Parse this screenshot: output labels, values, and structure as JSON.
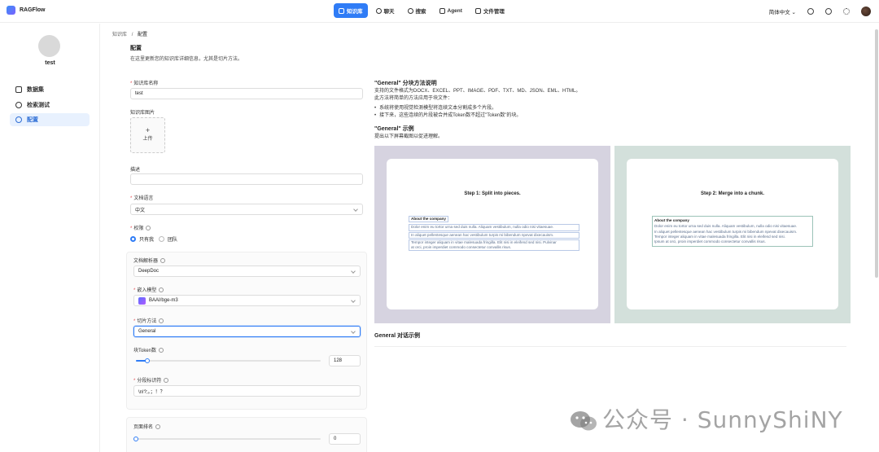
{
  "app": {
    "name": "RAGFlow"
  },
  "nav": [
    {
      "label": "知识库",
      "icon": "database-icon",
      "active": true
    },
    {
      "label": "聊天",
      "icon": "chat-icon"
    },
    {
      "label": "搜索",
      "icon": "search-icon"
    },
    {
      "label": "Agent",
      "icon": "agent-icon"
    },
    {
      "label": "文件管理",
      "icon": "folder-icon"
    }
  ],
  "header": {
    "language": "简体中文"
  },
  "sidebar": {
    "kb_name": "test",
    "items": [
      {
        "label": "数据集",
        "icon": "document-icon"
      },
      {
        "label": "检索测试",
        "icon": "target-icon"
      },
      {
        "label": "配置",
        "icon": "gear-icon",
        "active": true
      }
    ]
  },
  "breadcrumb": {
    "parent": "知识库",
    "sep": "/",
    "current": "配置"
  },
  "page": {
    "title": "配置",
    "subtitle": "在这里更新您的知识库详细信息，尤其是切片方法。"
  },
  "form": {
    "kb_name_label": "知识库名称",
    "kb_name_value": "test",
    "kb_image_label": "知识库图片",
    "upload_plus": "+",
    "upload_label": "上传",
    "description_label": "描述",
    "description_value": "",
    "language_label": "文档语言",
    "language_value": "中文",
    "permission_label": "权限",
    "permission_options": [
      "只有我",
      "团队"
    ],
    "parser_label": "文档解析器",
    "parser_value": "DeepDoc",
    "embedding_label": "嵌入模型",
    "embedding_value": "BAAI/bge-m3",
    "chunk_method_label": "切片方法",
    "chunk_method_value": "General",
    "token_label": "块Token数",
    "token_value": "128",
    "token_fraction": 0.06,
    "delimiter_label": "分段标识符",
    "delimiter_value": "\\n!?;。；！？",
    "page_rank_label": "页面排名",
    "page_rank_value": "0",
    "page_rank_fraction": 0.0
  },
  "info": {
    "title": "\"General\" 分块方法说明",
    "line1": "支持的文件格式为DOCX、EXCEL、PPT、IMAGE、PDF、TXT、MD、JSON、EML、HTML。",
    "line2": "此方法将简单的方法应用于块文件：",
    "bullets": [
      "系统将使用视觉检测模型将连续文本分割成多个片段。",
      "接下来，这些连续的片段被合并成Token数不超过\"Token数\"的块。"
    ],
    "example_title": "\"General\" 示例",
    "example_sub": "提出以下屏幕截图以促进理解。",
    "step1_title": "Step 1: Split into pieces.",
    "step2_title": "Step 2: Merge into a chunk.",
    "snippet_head": "About the company",
    "snippet_lines": [
      "Dolor enim eu tortor urna sed duis nulla. Aliquam vestibulum, nulla odio nisi vitaesuae.",
      "In aliquet pellentesque aenean hac vestibulum turpis mi bibendum npevat dixecauism.",
      "Tempor integer aliquam in vitae malesuada fringilla. Elit nisi in eleifend sed nisi. Pulvinar",
      "at orci, proin imperdiet commodo consectetur convallis risus."
    ],
    "snippet2_lines": [
      "Dolor enim eu tortor urna sed duis nulla. Aliquam vestibulum, nulla odio nisi vitaesuae.",
      "In aliquet pellentesque aenean hac vestibulum turpis mi bibendum npevat dixecauism.",
      "Tempor integer aliquam in vitae malesuada fringilla. Elit nisi in eleifend sed nisi.",
      "Ipsum at orci, proin imperdiet commodo consectetur convallis risus."
    ],
    "dialog_example_title": "General 对话示例"
  },
  "watermark": {
    "text": "公众号 · SunnyShiNY"
  },
  "colors": {
    "accent": "#2f7cf6",
    "step1_bg": "#d6d3e0",
    "step2_bg": "#d3e0db"
  }
}
